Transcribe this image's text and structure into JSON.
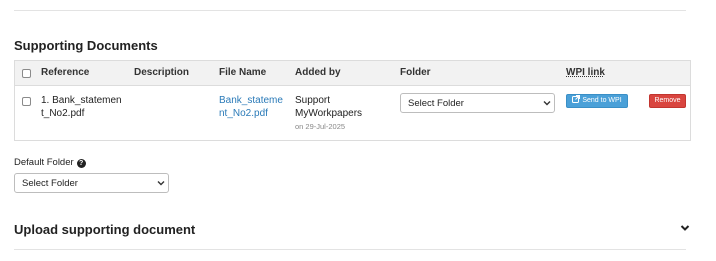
{
  "section_title": "Supporting Documents",
  "table": {
    "headers": {
      "reference": "Reference",
      "description": "Description",
      "file_name": "File Name",
      "added_by": "Added by",
      "folder": "Folder",
      "wpi_link": "WPI link"
    },
    "rows": [
      {
        "reference_line1": "1. Bank_statemen",
        "reference_line2": "t_No2.pdf",
        "description": "",
        "file_line1": "Bank_stateme",
        "file_line2": "nt_No2.pdf",
        "added_by_line1": "Support",
        "added_by_line2": "MyWorkpapers",
        "added_on": "on 29-Jul-2025",
        "folder_select": "Select Folder",
        "send_button": "Send to WPI",
        "remove_button": "Remove"
      }
    ]
  },
  "default_folder": {
    "label": "Default Folder",
    "help_glyph": "?",
    "select_value": "Select Folder"
  },
  "upload": {
    "title": "Upload supporting document"
  },
  "colors": {
    "link": "#2a7ab8",
    "send_button": "#4aa0d8",
    "remove_button": "#d9453f",
    "header_bg": "#f2f2f2"
  },
  "icons": {
    "send": "external-link-icon",
    "select": "chevron-down-icon",
    "help": "question-circle-icon",
    "collapse": "chevron-down-icon"
  }
}
